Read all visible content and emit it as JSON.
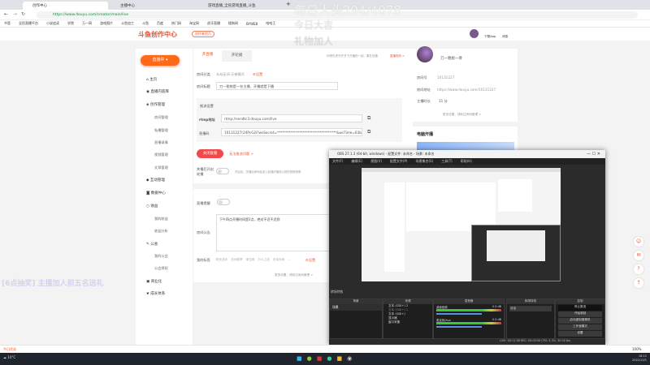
{
  "browser": {
    "tabs": [
      "创作中心",
      "主播中心",
      "游戏直播_全民游戏直播_斗鱼"
    ],
    "new_tab": "+",
    "url": "https://www.douyu.com/creator/main/live",
    "bookmarks": [
      "书签",
      "全民直播平台",
      "小说追读",
      "学院",
      "万一网",
      "游戏图片",
      "斗鱼加工",
      "斗鱼",
      "百度",
      "热门网",
      "淘宝网",
      "虎牙直播",
      "搜狗网",
      "BYWEB",
      "哈哈王"
    ]
  },
  "header": {
    "logo": "斗鱼创作中心",
    "creator_btn": "创作者首页",
    "user_links": [
      "下载App",
      "消息"
    ]
  },
  "sidebar": {
    "live_button": "直播中",
    "items": [
      {
        "label": "主页",
        "icon": "home-icon"
      },
      {
        "label": "直播内容库",
        "icon": "library-icon"
      },
      {
        "label": "创作管理",
        "icon": "manage-icon",
        "subs": [
          "房间管理",
          "私播管理",
          "直播录像",
          "视频管理",
          "文章管理"
        ]
      },
      {
        "label": "互动管理",
        "icon": "interact-icon"
      },
      {
        "label": "数据中心",
        "icon": "data-icon"
      },
      {
        "label": "收益",
        "icon": "income-icon",
        "subs": [
          "我的收益",
          "收益分析"
        ]
      },
      {
        "label": "公会",
        "icon": "guild-icon",
        "subs": [
          "我的公会",
          "公会授权"
        ]
      },
      {
        "label": "商业化",
        "icon": "business-icon"
      },
      {
        "label": "成长体系",
        "icon": "growth-icon"
      }
    ]
  },
  "main": {
    "tabs": [
      "开直播",
      "开轮播"
    ],
    "tip": "你想在虎牙开关下开播的一起、要在设置",
    "tip_link": "直播规则 >",
    "category_label": "房间分类",
    "category_value": "永劫无间·天梯模式",
    "category_set": "设置",
    "title_label": "房间标题",
    "title_value": "刀一税统是一名主播、开播就是下播",
    "push_title": "推流设置",
    "rtmp_label": "rtmp地址",
    "rtmp_value": "rtmp://sendtc3.douyu.com/live",
    "key_label": "直播码",
    "key_value": "10131227r24PcG2l?wsSecret=***********************************&wsTime=63b16",
    "close_live": "关闭直播",
    "help_link": "无法推流问题 >",
    "auto_label": "关播后开启轮播",
    "auto_desc": "开启后，关播后房间会进入轮播内播放以前的视频录像",
    "notice_toggle_label": "直播提醒",
    "notice_label": "房间公告",
    "notice_value": "下午四点开播时间是2点，绝对不迟不迟到",
    "tags_label": "我的标签",
    "tags": [
      "职业选手",
      "无间修罗",
      "单位角",
      "万人之战",
      "永劫无间",
      "..."
    ],
    "tags_set": "设置",
    "more_link": "更多设置，请前往房间管理 >"
  },
  "profile": {
    "name": "刀一税统一骨",
    "room_label": "房间号",
    "room": "10131227",
    "addr_label": "房间地址",
    "addr": "https://www.douyu.com/10131227",
    "live_label": "主播时长",
    "live": "11 分",
    "more": "更多设置，请前往房间管理 >",
    "pc_title": "电脑开播"
  },
  "obs": {
    "title": "OBS 27.1.3 (64-bit, windows) - 配置文件: 未命名 - 场景: 未命名",
    "menu": [
      "文件(F)",
      "编辑(E)",
      "视图(V)",
      "配置文件(P)",
      "场景集合(S)",
      "工具(T)",
      "帮助(H)"
    ],
    "transition_label": "转场特效",
    "docks": [
      "场景",
      "来源",
      "混音器",
      "转场特效",
      "控制"
    ],
    "scene": "场景",
    "sources": [
      "文本 (GDI+) 2",
      "文本 (GDI+) 1",
      "文本 (GDI+)",
      "显示器",
      "窗口采集"
    ],
    "mixer": [
      {
        "name": "桌面音频",
        "db": "0.0 dB"
      },
      {
        "name": "麦克风/Aux",
        "db": "0.0 dB"
      }
    ],
    "transition": "淡出",
    "controls": [
      "停止推流",
      "开始录制",
      "启动虚拟摄像机",
      "工作室模式",
      "设置",
      "退出"
    ],
    "status": "LIVE: 00:11:38  REC: 00:00:00  CPU: 4.3%, 30.00 fps"
  },
  "statusbar": {
    "left": "今日优选",
    "right": "100%"
  },
  "taskbar": {
    "weather": "10°C",
    "time": "16:12",
    "date": "2022/12/1"
  },
  "watermark": {
    "top": "每日人头294/4078",
    "sub1": "今日大吉",
    "sub2": "礼物加人",
    "left": "[6点抽奖] 主播加人前五名送礼"
  },
  "colors": {
    "accent": "#ff6a1a",
    "brand": "#f05a28"
  }
}
